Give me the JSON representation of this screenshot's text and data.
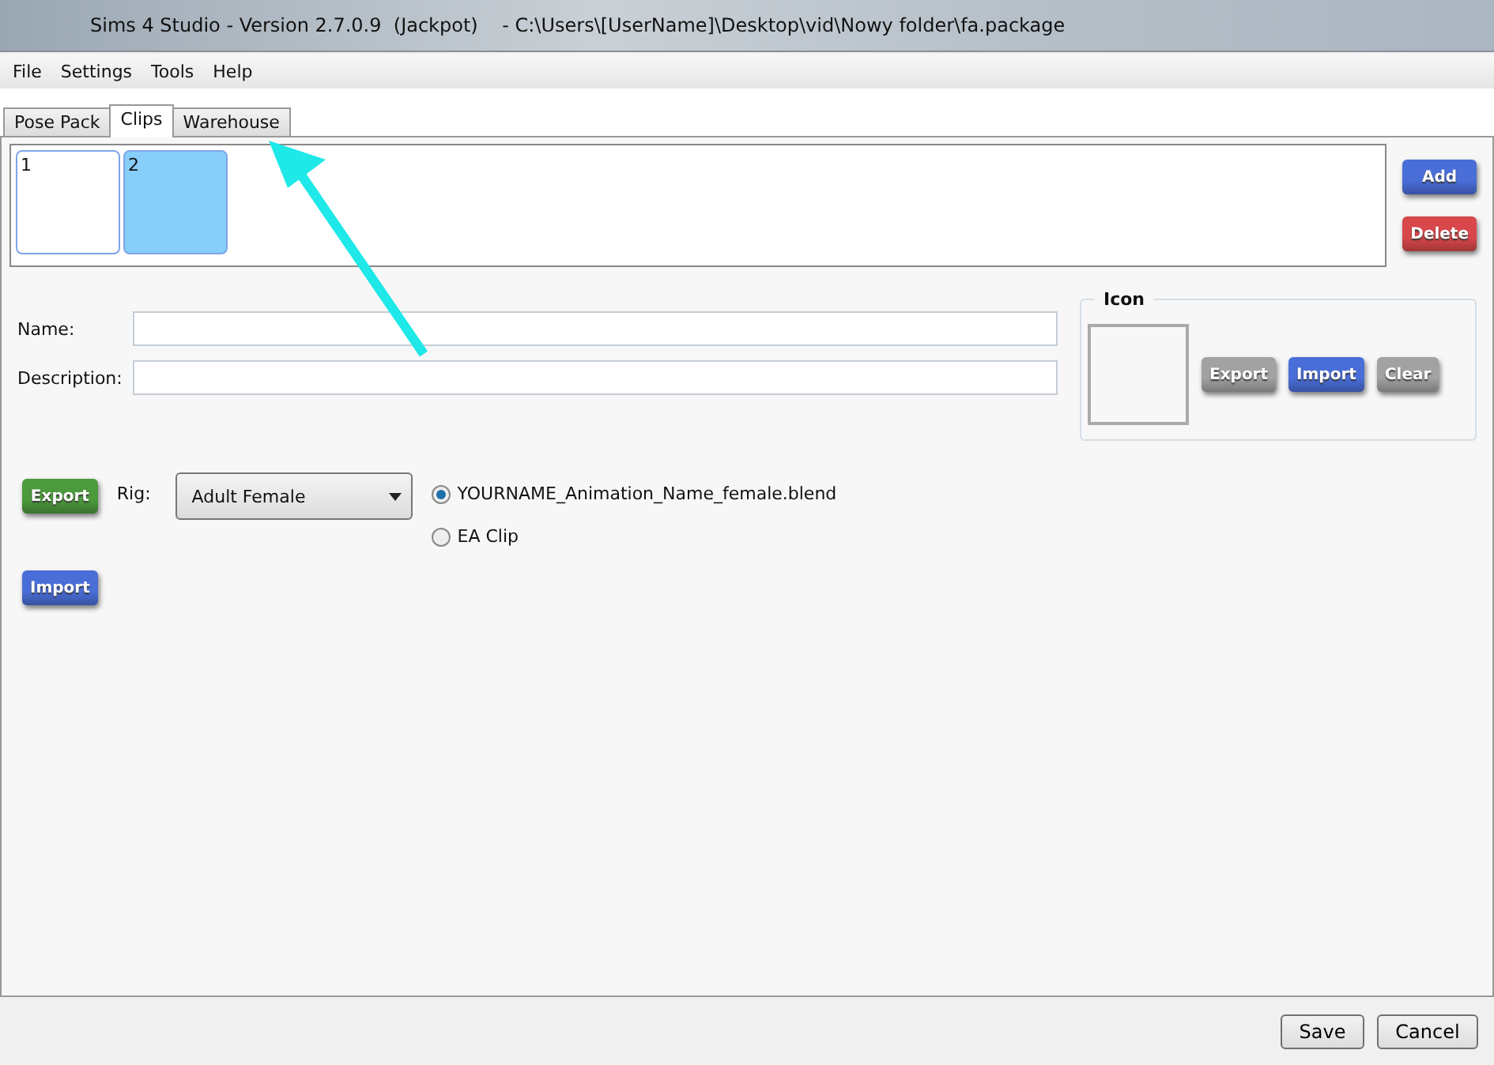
{
  "window": {
    "title": "Sims 4 Studio - Version 2.7.0.9  (Jackpot)    - C:\\Users\\[UserName]\\Desktop\\vid\\Nowy folder\\fa.package"
  },
  "menu": [
    "File",
    "Settings",
    "Tools",
    "Help"
  ],
  "tabs": [
    {
      "label": "Pose Pack",
      "selected": false
    },
    {
      "label": "Clips",
      "selected": true
    },
    {
      "label": "Warehouse",
      "selected": false
    }
  ],
  "clips": [
    {
      "label": "1",
      "selected": false
    },
    {
      "label": "2",
      "selected": true
    }
  ],
  "clip_buttons": [
    {
      "label": "Add",
      "kind": "blue"
    },
    {
      "label": "Delete",
      "kind": "red"
    }
  ],
  "fields": [
    {
      "label": "Name:"
    },
    {
      "label": "Description:"
    }
  ],
  "icon_group": {
    "title": "Icon",
    "buttons": [
      {
        "label": "Export",
        "kind": "gray"
      },
      {
        "label": "Import",
        "kind": "blue"
      },
      {
        "label": "Clear",
        "kind": "gray"
      }
    ]
  },
  "export_button": {
    "label": "Export",
    "kind": "green"
  },
  "import_button": {
    "label": "Import",
    "kind": "blue"
  },
  "rig": {
    "label": "Rig:",
    "value": "Adult Female"
  },
  "options": [
    {
      "label": "YOURNAME_Animation_Name_female.blend",
      "selected": true
    },
    {
      "label": "EA Clip",
      "selected": false
    }
  ],
  "footer_buttons": [
    "Save",
    "Cancel"
  ]
}
